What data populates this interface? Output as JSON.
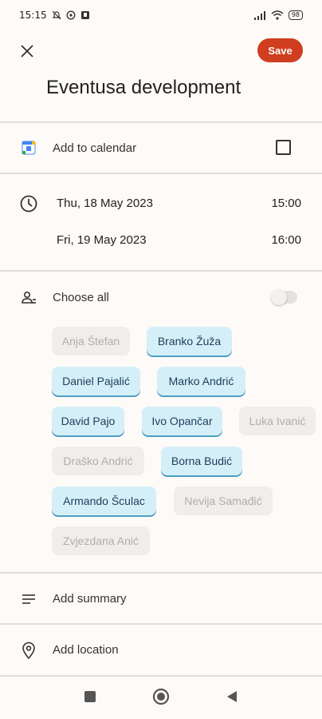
{
  "status_bar": {
    "time": "15:15",
    "battery": "98",
    "left_icons": [
      "dnd-icon",
      "whatsapp-icon",
      "notification-icon"
    ],
    "right_icons": [
      "signal-icon",
      "wifi-icon",
      "battery-icon"
    ]
  },
  "toolbar": {
    "save_label": "Save"
  },
  "event": {
    "title": "Eventusa development"
  },
  "calendar_row": {
    "label": "Add to calendar",
    "checked": false
  },
  "datetime": {
    "start_date": "Thu, 18 May 2023",
    "start_time": "15:00",
    "end_date": "Fri, 19 May 2023",
    "end_time": "16:00"
  },
  "participants": {
    "choose_all_label": "Choose all",
    "choose_all_on": false,
    "chips": [
      {
        "name": "Anja Štefan",
        "selected": false
      },
      {
        "name": "Branko Žuža",
        "selected": true
      },
      {
        "name": "Daniel Pajalić",
        "selected": true
      },
      {
        "name": "Marko Andrić",
        "selected": true
      },
      {
        "name": "David Pajo",
        "selected": true
      },
      {
        "name": "Ivo Opančar",
        "selected": true
      },
      {
        "name": "Luka Ivanić",
        "selected": false
      },
      {
        "name": "Draško Andrić",
        "selected": false
      },
      {
        "name": "Borna Budić",
        "selected": true
      },
      {
        "name": "Armando Šculac",
        "selected": true
      },
      {
        "name": "Nevija Samađić",
        "selected": false
      },
      {
        "name": "Zvjezdana Anić",
        "selected": false
      }
    ]
  },
  "summary": {
    "placeholder": "Add summary"
  },
  "location": {
    "placeholder": "Add location"
  },
  "colors": {
    "accent": "#cf3e1f",
    "chip_selected_bg": "#d5eff9",
    "chip_unselected_bg": "#f0eeec",
    "background": "#fdfaf7"
  }
}
